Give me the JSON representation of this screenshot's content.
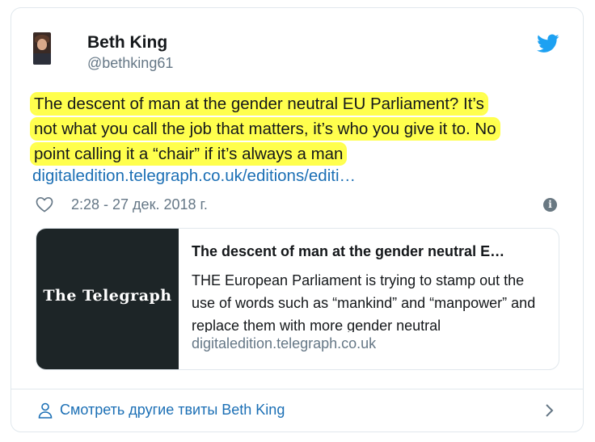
{
  "author": {
    "name": "Beth King",
    "handle": "@bethking61",
    "avatar_icon": "avatar"
  },
  "tweet": {
    "lines": [
      "The descent of man at the gender neutral EU Parliament? It’s",
      "not what you call the job that matters, it’s who you give it to. No",
      "point calling it a “chair” if it’s always a man"
    ],
    "link": "digitaledition.telegraph.co.uk/editions/editi…",
    "timestamp": "2:28 - 27 дек. 2018 г.",
    "highlight_color": "#ffff4d"
  },
  "preview": {
    "logo": "The Telegraph",
    "title": "The descent of man at the gender neutral E…",
    "description": "THE European Parliament is trying to stamp out the use of words such as “mankind” and “manpower” and replace them with more gender neutral",
    "domain": "digitaledition.telegraph.co.uk"
  },
  "footer": {
    "more_label": "Смотреть другие твиты Beth King"
  },
  "colors": {
    "twitter_blue": "#1da1f2",
    "link": "#1b6fb5",
    "muted": "#657786"
  }
}
